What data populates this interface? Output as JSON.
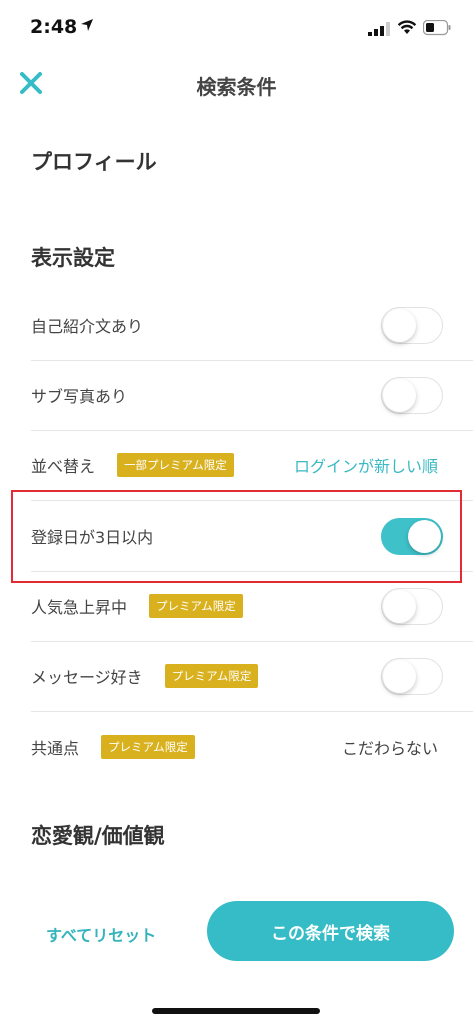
{
  "status": {
    "time": "2:48"
  },
  "nav": {
    "title": "検索条件"
  },
  "sections": {
    "profile": "プロフィール",
    "display": "表示設定",
    "values": "恋愛観/価値観"
  },
  "rows": [
    {
      "label": "自己紹介文あり",
      "control": "toggle",
      "on": false
    },
    {
      "label": "サブ写真あり",
      "control": "toggle",
      "on": false
    },
    {
      "label": "並べ替え",
      "badge": "一部プレミアム限定",
      "control": "value",
      "value": "ログインが新しい順"
    },
    {
      "label": "登録日が3日以内",
      "control": "toggle",
      "on": true
    },
    {
      "label": "人気急上昇中",
      "badge": "プレミアム限定",
      "control": "toggle",
      "on": false
    },
    {
      "label": "メッセージ好き",
      "badge": "プレミアム限定",
      "control": "toggle",
      "on": false
    },
    {
      "label": "共通点",
      "badge": "プレミアム限定",
      "control": "value",
      "value": "こだわらない"
    }
  ],
  "footer": {
    "reset_label": "すべてリセット",
    "search_label": "この条件で検索"
  },
  "colors": {
    "accent": "#35bcc6",
    "badge": "#d9b11f",
    "highlight": "#e32b36"
  }
}
